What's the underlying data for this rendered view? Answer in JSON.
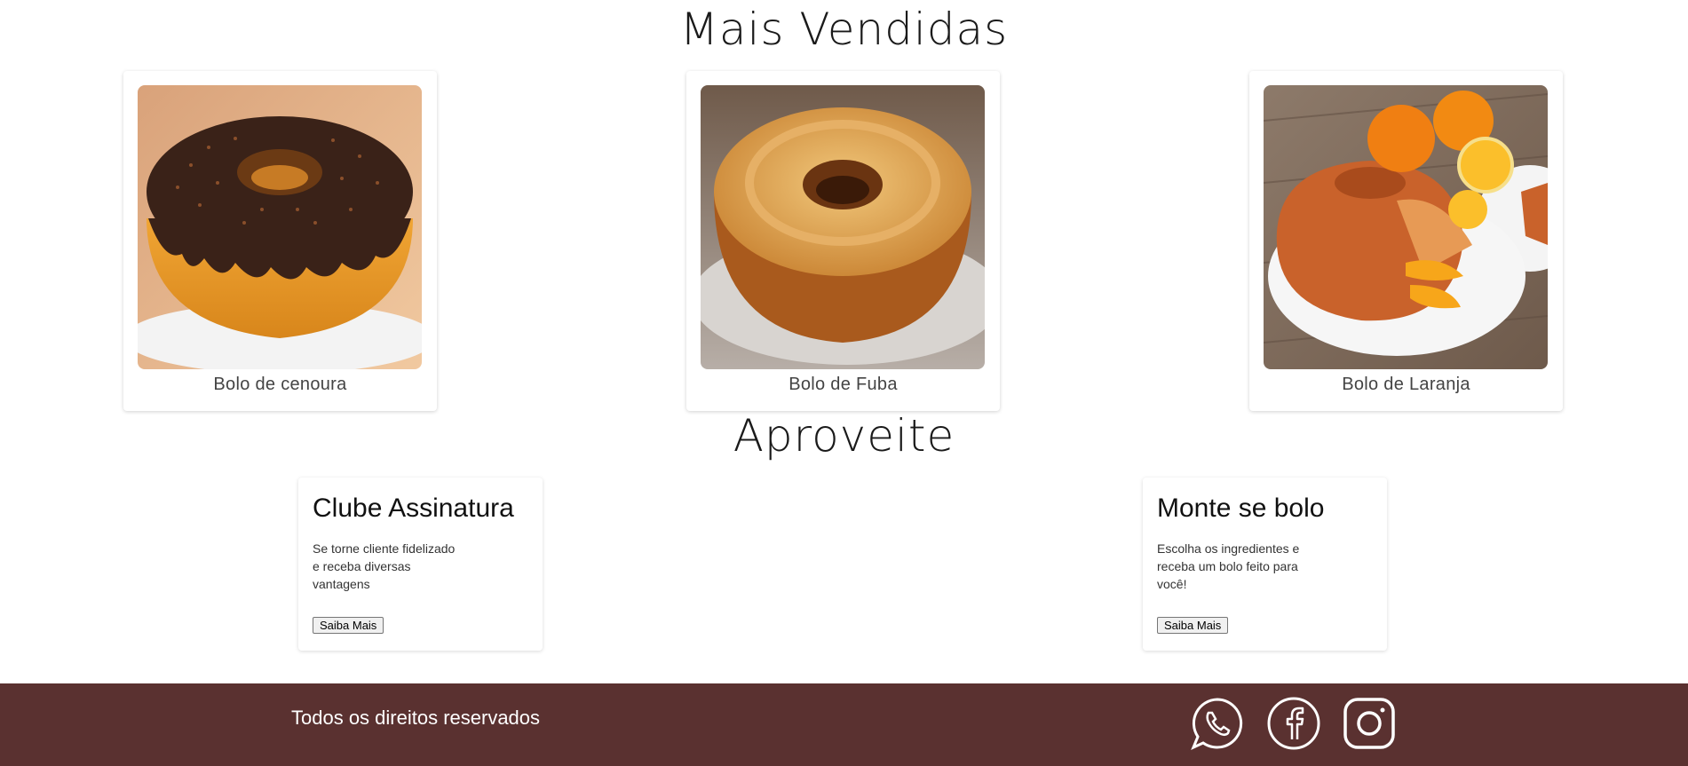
{
  "sections": {
    "best_sellers_title": "Mais Vendidas",
    "offers_title": "Aproveite"
  },
  "products": [
    {
      "name": "Bolo de cenoura",
      "image": "chocolate-carrot-bundt-cake-photo"
    },
    {
      "name": "Bolo de Fuba",
      "image": "cornmeal-bundt-cake-photo"
    },
    {
      "name": "Bolo de Laranja",
      "image": "orange-bundt-cake-photo"
    }
  ],
  "promos": [
    {
      "title": "Clube Assinatura",
      "text": "Se torne cliente fidelizado e receba diversas vantagens",
      "button": "Saiba Mais"
    },
    {
      "title": "Monte se bolo",
      "text": "Escolha os ingredientes e receba um bolo feito para você!",
      "button": "Saiba Mais"
    }
  ],
  "footer": {
    "rights": "Todos os direitos reservados",
    "social": [
      "whatsapp-icon",
      "facebook-icon",
      "instagram-icon"
    ]
  },
  "colors": {
    "footer_bg": "#5a3130",
    "footer_text": "#ffffff"
  }
}
